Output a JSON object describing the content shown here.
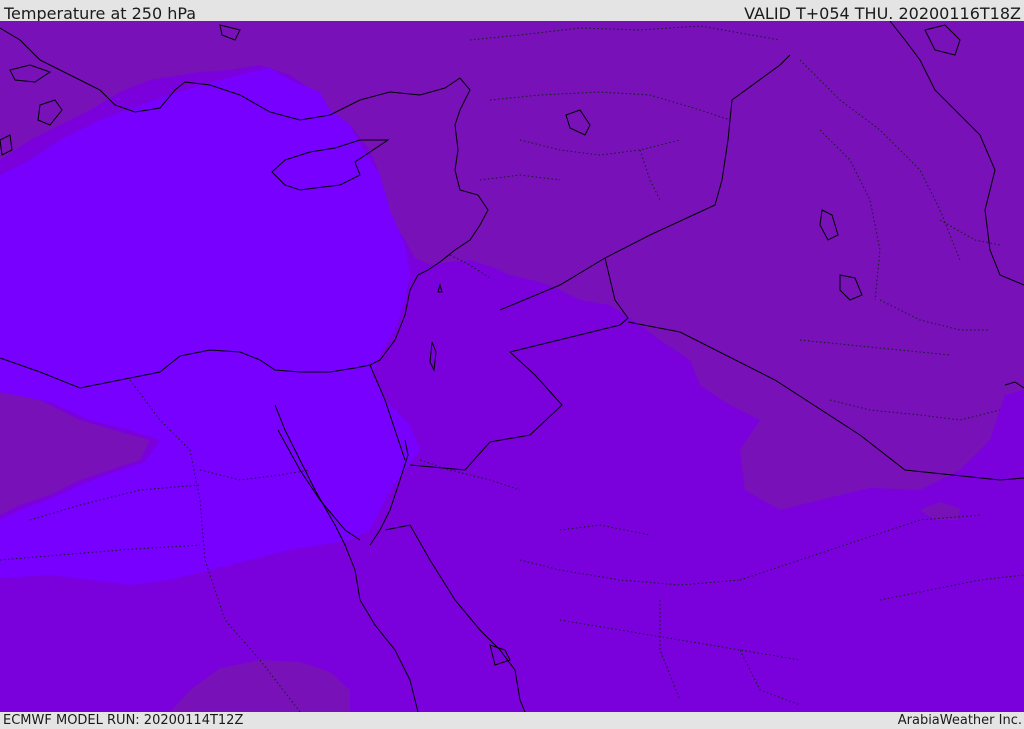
{
  "header": {
    "title": "Temperature at 250 hPa",
    "valid_time": "VALID T+054 THU. 20200116T18Z"
  },
  "footer": {
    "model_run": "ECMWF MODEL RUN: 20200114T12Z",
    "credit": "ArabiaWeather Inc."
  },
  "map": {
    "region": "Eastern Mediterranean and Middle East",
    "colors": {
      "dark_band": "#7811b8",
      "mid_band": "#7a00dc",
      "bright_band": "#7700fe",
      "coastline": "#000000",
      "borders": "#1a1a2a"
    }
  }
}
